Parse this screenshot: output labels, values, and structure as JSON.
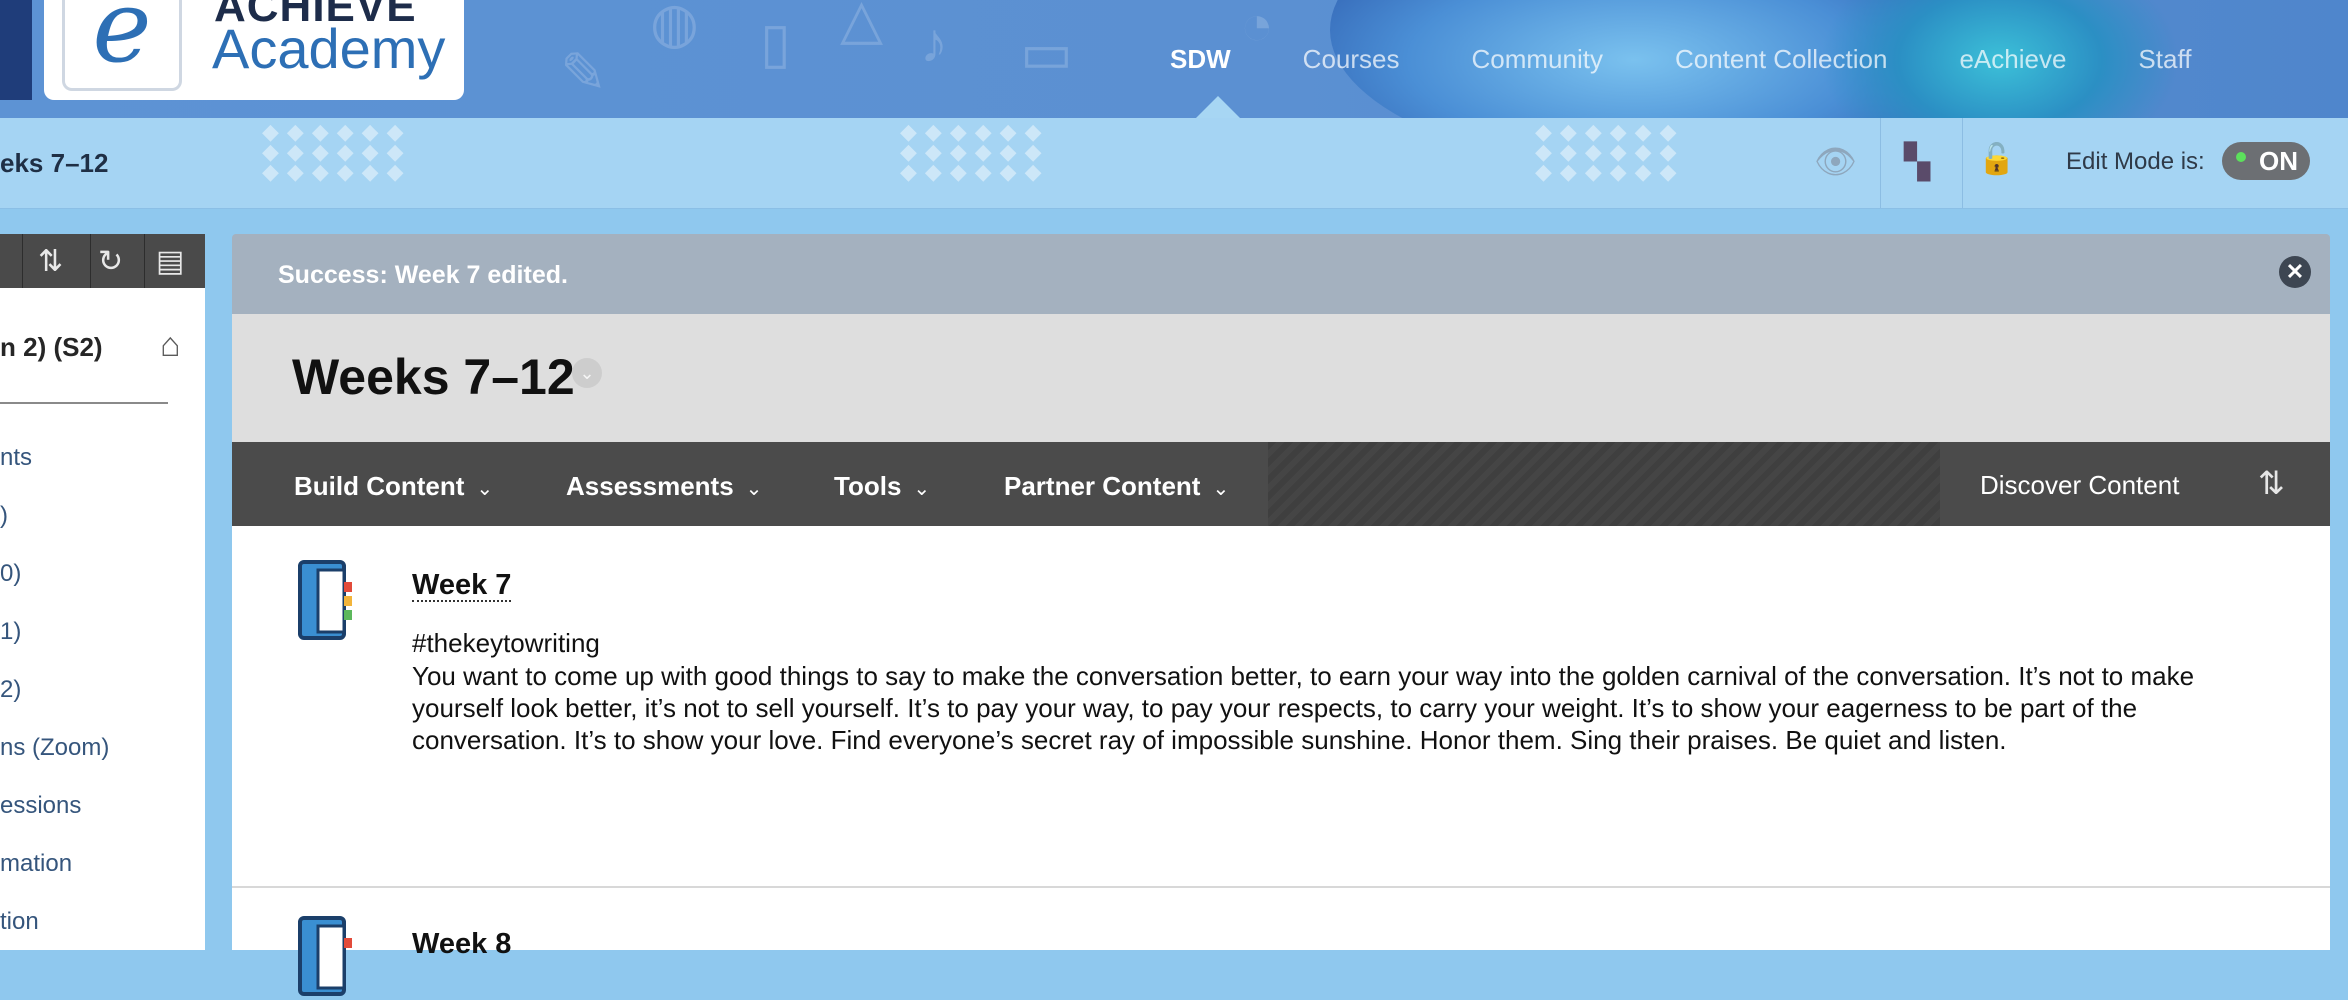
{
  "brand": {
    "logo_line1": "ACHIEVE",
    "logo_line2": "Academy",
    "logo_letter": "e"
  },
  "nav": {
    "items": [
      {
        "label": "SDW",
        "active": true
      },
      {
        "label": "Courses"
      },
      {
        "label": "Community"
      },
      {
        "label": "Content Collection"
      },
      {
        "label": "eAchieve"
      },
      {
        "label": "Staff"
      }
    ]
  },
  "breadcrumb": {
    "current": "eks 7–12"
  },
  "edit_mode": {
    "label": "Edit Mode is:",
    "state": "ON",
    "lock_count": "0"
  },
  "left_panel": {
    "course_title": "n 2) (S2)",
    "links": [
      "nts",
      ")",
      " 0)",
      " 1)",
      " 2)",
      "ns (Zoom)",
      "essions",
      "mation",
      "tion"
    ]
  },
  "success": {
    "message": "Success: Week 7 edited."
  },
  "page": {
    "title": "Weeks 7–12"
  },
  "action_bar": {
    "menus": [
      "Build Content",
      "Assessments",
      "Tools",
      "Partner Content"
    ],
    "discover": "Discover Content"
  },
  "content_items": [
    {
      "title": "Week 7",
      "tag": "#thekeytowriting",
      "body": "You want to come up with good things to say to make the conversation better, to earn your way into the golden carnival of the conversation. It’s not to make yourself look better, it’s not to sell yourself. It’s to pay your way, to pay your respects, to carry your weight. It’s to show your eagerness to be part of the conversation. It’s to show your love. Find everyone’s secret ray of impossible sunshine. Honor them. Sing their praises. Be quiet and listen."
    },
    {
      "title": "Week 8"
    }
  ],
  "colors": {
    "banner": "#5b90d2",
    "crumb_bar": "#a5d4f3",
    "action_bar": "#4b4b4b",
    "success_bar": "#a4b1bf"
  }
}
